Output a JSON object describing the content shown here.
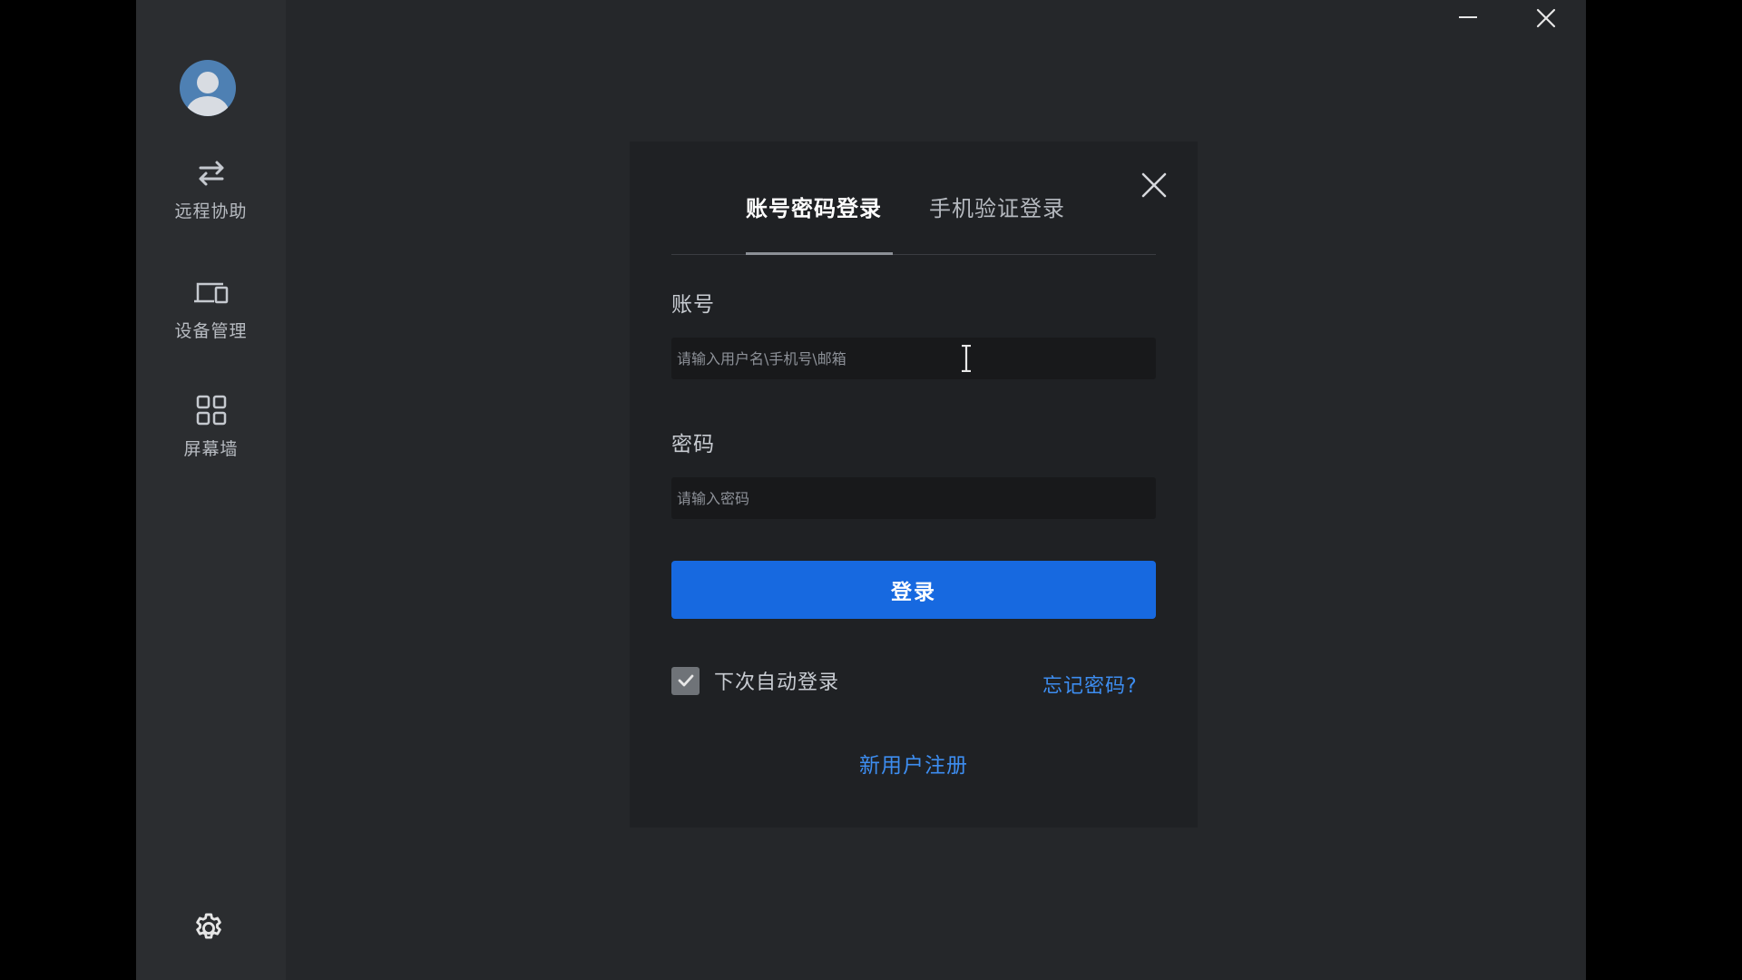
{
  "sidebar": {
    "items": [
      {
        "label": "远程协助",
        "icon": "swap-arrows-icon"
      },
      {
        "label": "设备管理",
        "icon": "devices-icon"
      },
      {
        "label": "屏幕墙",
        "icon": "grid-icon"
      }
    ],
    "settings_icon": "gear-icon",
    "avatar_icon": "user-avatar-icon"
  },
  "window": {
    "minimize_icon": "minimize-icon",
    "close_icon": "close-icon"
  },
  "dialog": {
    "tabs": [
      {
        "label": "账号密码登录",
        "active": true
      },
      {
        "label": "手机验证登录",
        "active": false
      }
    ],
    "account": {
      "label": "账号",
      "placeholder": "请输入用户名\\手机号\\邮箱",
      "value": ""
    },
    "password": {
      "label": "密码",
      "placeholder": "请输入密码",
      "value": ""
    },
    "login_label": "登录",
    "remember_label": "下次自动登录",
    "remember_checked": true,
    "forgot_label": "忘记密码?",
    "register_label": "新用户注册"
  },
  "colors": {
    "background": "#25272a",
    "sidebar": "#2b2d30",
    "dialog": "#1f2124",
    "primary": "#1769e0",
    "link": "#3d8df0"
  }
}
